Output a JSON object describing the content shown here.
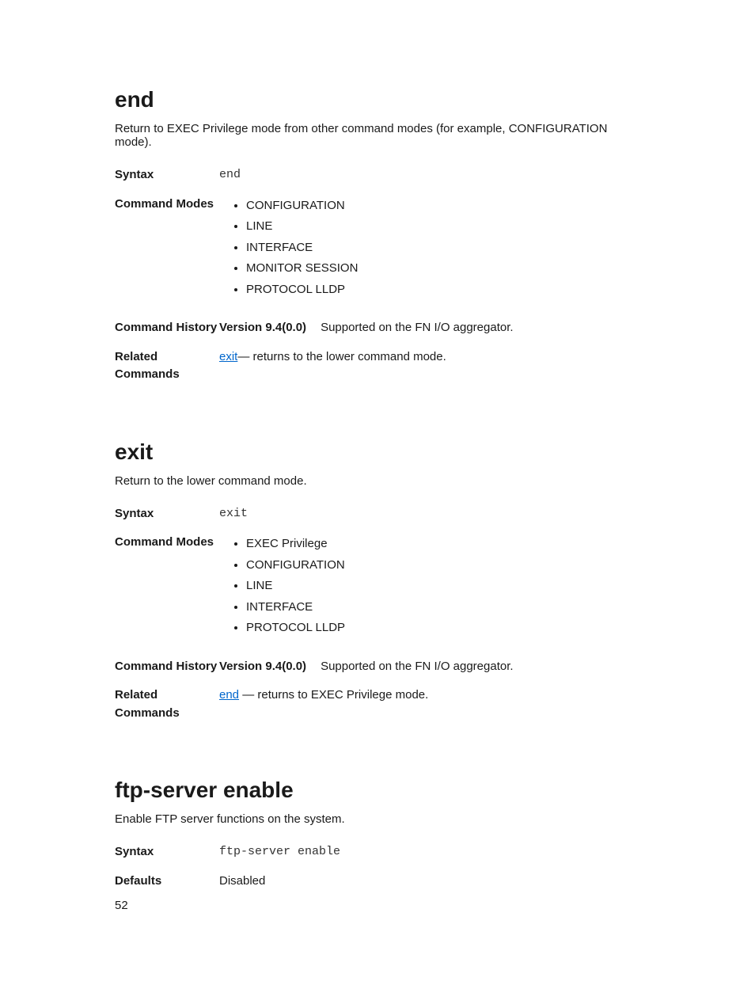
{
  "sections": [
    {
      "title": "end",
      "desc": "Return to EXEC Privilege mode from other command modes (for example, CONFIGURATION mode).",
      "syntax": "end",
      "modes": [
        "CONFIGURATION",
        "LINE",
        "INTERFACE",
        "MONITOR SESSION",
        "PROTOCOL LLDP"
      ],
      "history": {
        "version": "Version 9.4(0.0)",
        "note": "Supported on the FN I/O aggregator."
      },
      "related": {
        "link": "exit",
        "text": "— returns to the lower command mode."
      }
    },
    {
      "title": "exit",
      "desc": "Return to the lower command mode.",
      "syntax": "exit",
      "modes": [
        "EXEC Privilege",
        "CONFIGURATION",
        "LINE",
        "INTERFACE",
        "PROTOCOL LLDP"
      ],
      "history": {
        "version": "Version 9.4(0.0)",
        "note": "Supported on the FN I/O aggregator."
      },
      "related": {
        "link": "end",
        "text": " — returns to EXEC Privilege mode."
      }
    },
    {
      "title": "ftp-server enable",
      "desc": "Enable FTP server functions on the system.",
      "syntax": "ftp-server enable",
      "defaults": "Disabled"
    }
  ],
  "labels": {
    "syntax": "Syntax",
    "modes": "Command Modes",
    "history": "Command History",
    "related": "Related Commands",
    "defaults": "Defaults"
  },
  "pageNumber": "52"
}
